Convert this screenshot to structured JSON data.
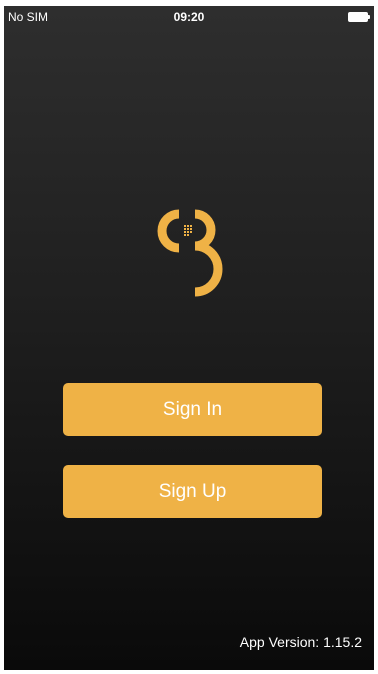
{
  "status_bar": {
    "carrier": "No SIM",
    "time": "09:20",
    "battery_icon": "battery-full-icon"
  },
  "logo": {
    "icon": "app-logo-icon",
    "color": "#efb246"
  },
  "actions": {
    "sign_in_label": "Sign In",
    "sign_up_label": "Sign Up",
    "button_color": "#efb246"
  },
  "footer": {
    "version_text": "App Version: 1.15.2"
  }
}
